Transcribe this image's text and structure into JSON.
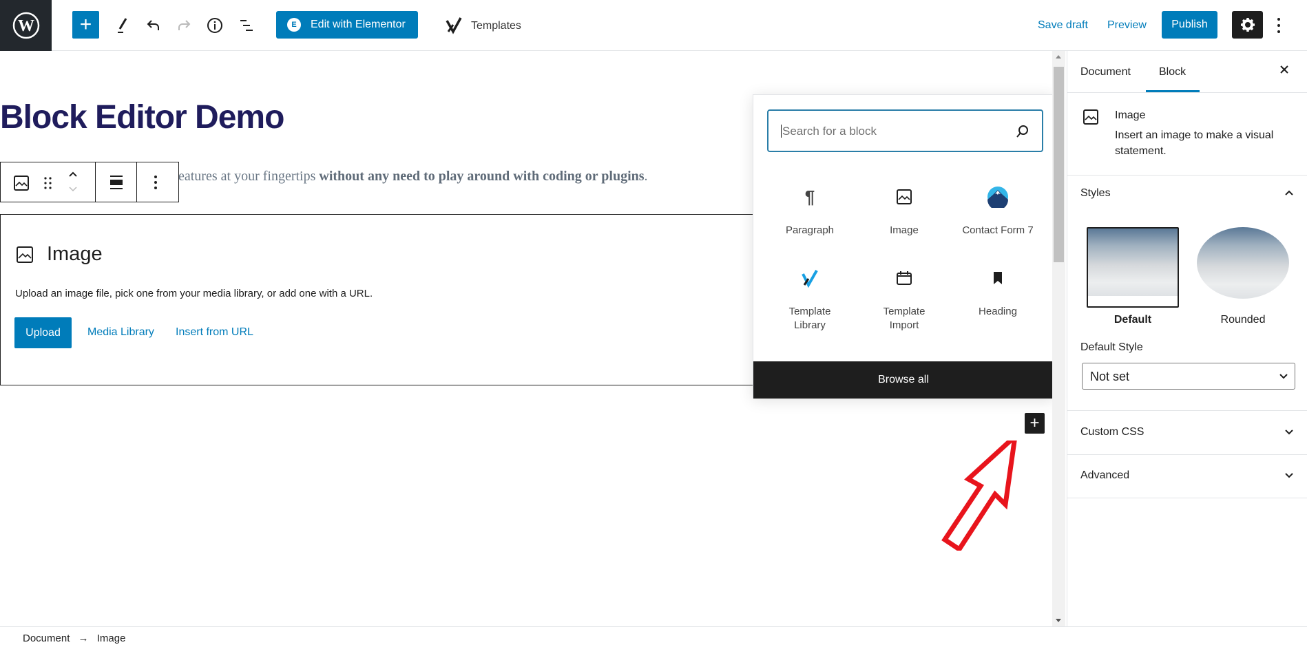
{
  "toolbar": {
    "edit_elementor": "Edit with Elementor",
    "templates": "Templates",
    "save_draft": "Save draft",
    "preview": "Preview",
    "publish": "Publish"
  },
  "content": {
    "title": "Block Editor Demo",
    "para_visible": "eatures at your fingertips ",
    "para_bold": "without any need to play around with coding or plugins",
    "para_end": "."
  },
  "image_block": {
    "title": "Image",
    "description": "Upload an image file, pick one from your media library, or add one with a URL.",
    "upload": "Upload",
    "media_library": "Media Library",
    "insert_url": "Insert from URL"
  },
  "inserter": {
    "search_placeholder": "Search for a block",
    "blocks": [
      {
        "label": "Paragraph",
        "icon": "pilcrow-icon"
      },
      {
        "label": "Image",
        "icon": "image-icon"
      },
      {
        "label": "Contact Form 7",
        "icon": "mountain-icon"
      },
      {
        "label": "Template Library",
        "icon": "template-library-icon"
      },
      {
        "label": "Template Import",
        "icon": "calendar-icon"
      },
      {
        "label": "Heading",
        "icon": "bookmark-icon"
      }
    ],
    "browse_all": "Browse all"
  },
  "sidebar": {
    "tabs": [
      "Document",
      "Block"
    ],
    "active_tab": "Block",
    "block_title": "Image",
    "block_desc": "Insert an image to make a visual statement.",
    "styles_title": "Styles",
    "styles": [
      "Default",
      "Rounded"
    ],
    "active_style": "Default",
    "default_style_label": "Default Style",
    "default_style_value": "Not set",
    "custom_css": "Custom CSS",
    "advanced": "Advanced"
  },
  "breadcrumb": {
    "items": [
      "Document",
      "Image"
    ],
    "separator": "→"
  },
  "colors": {
    "accent": "#007cba",
    "dark": "#1e1e1e",
    "title": "#1f1c5c",
    "annotation_arrow": "#e8141c"
  }
}
